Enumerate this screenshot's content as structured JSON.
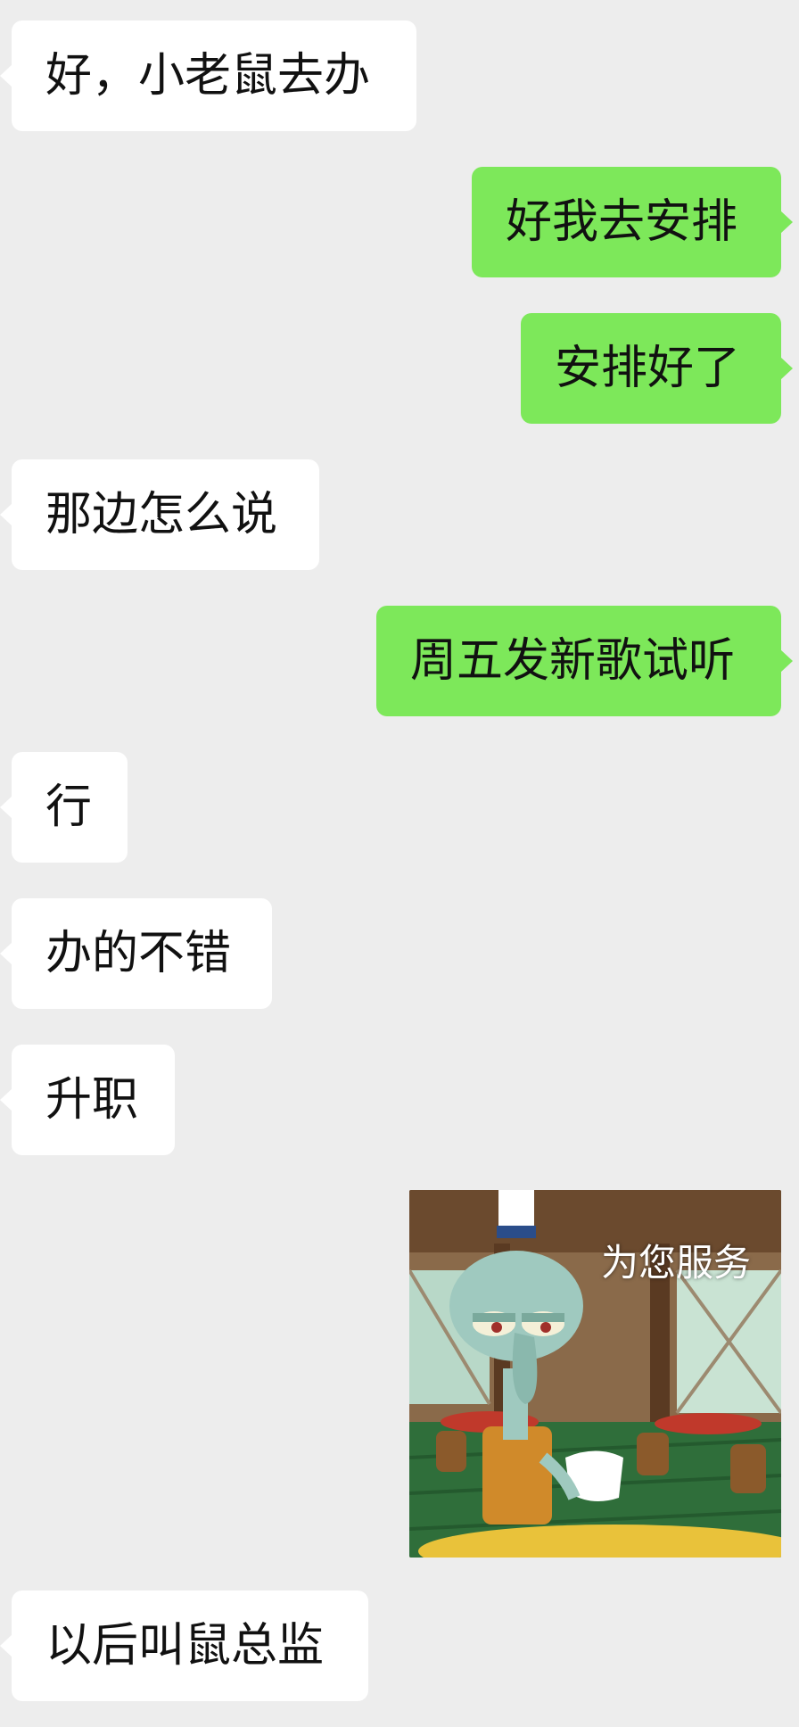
{
  "messages": [
    {
      "side": "left",
      "text": "好，小老鼠去办"
    },
    {
      "side": "right",
      "text": "好我去安排"
    },
    {
      "side": "right",
      "text": "安排好了"
    },
    {
      "side": "left",
      "text": "那边怎么说"
    },
    {
      "side": "right",
      "text": "周五发新歌试听"
    },
    {
      "side": "left",
      "text": "行"
    },
    {
      "side": "left",
      "text": "办的不错"
    },
    {
      "side": "left",
      "text": "升职"
    },
    {
      "side": "right",
      "type": "sticker",
      "caption": "为您服务",
      "icon": "squidward-waiter-sticker"
    },
    {
      "side": "left",
      "text": "以后叫鼠总监"
    }
  ],
  "colors": {
    "background": "#ededed",
    "incoming_bubble": "#ffffff",
    "outgoing_bubble": "#7de85a"
  }
}
